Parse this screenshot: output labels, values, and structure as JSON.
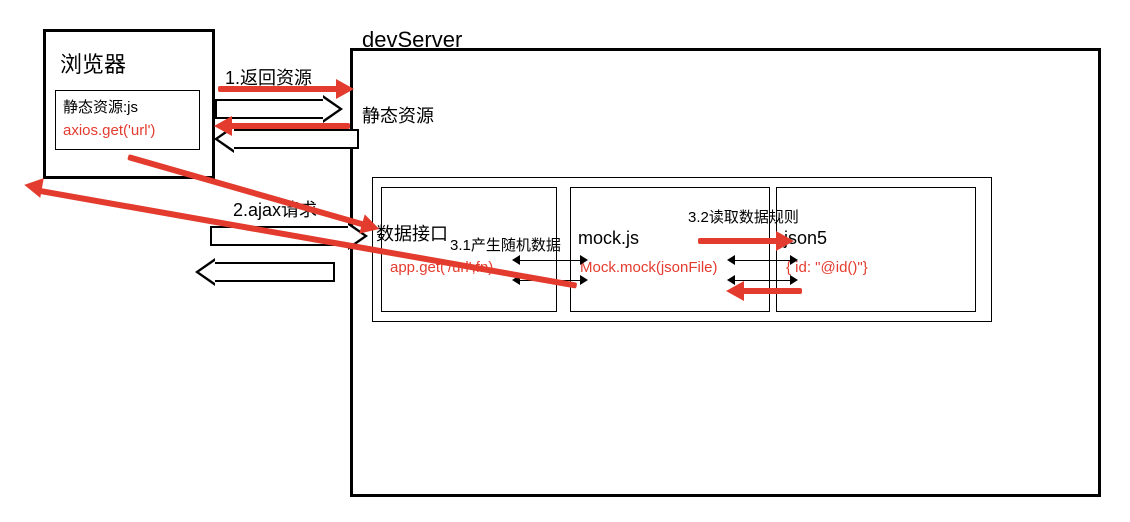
{
  "browser": {
    "title": "浏览器",
    "static_label": "静态资源:js",
    "code": "axios.get('url')"
  },
  "devserver": {
    "title": "devServer",
    "static_res": "静态资源",
    "data_api": "数据接口",
    "gen_random": "3.1产生随机数据",
    "app_get": "app.get('/url',fn)",
    "mockjs": "mock.js",
    "mockcall": "Mock.mock(jsonFile)",
    "read_rules": "3.2读取数据规则",
    "json5": "json5",
    "json_content": "{ id: \"@id()\"}"
  },
  "flow": {
    "step1": "1.返回资源",
    "step2": "2.ajax请求"
  }
}
